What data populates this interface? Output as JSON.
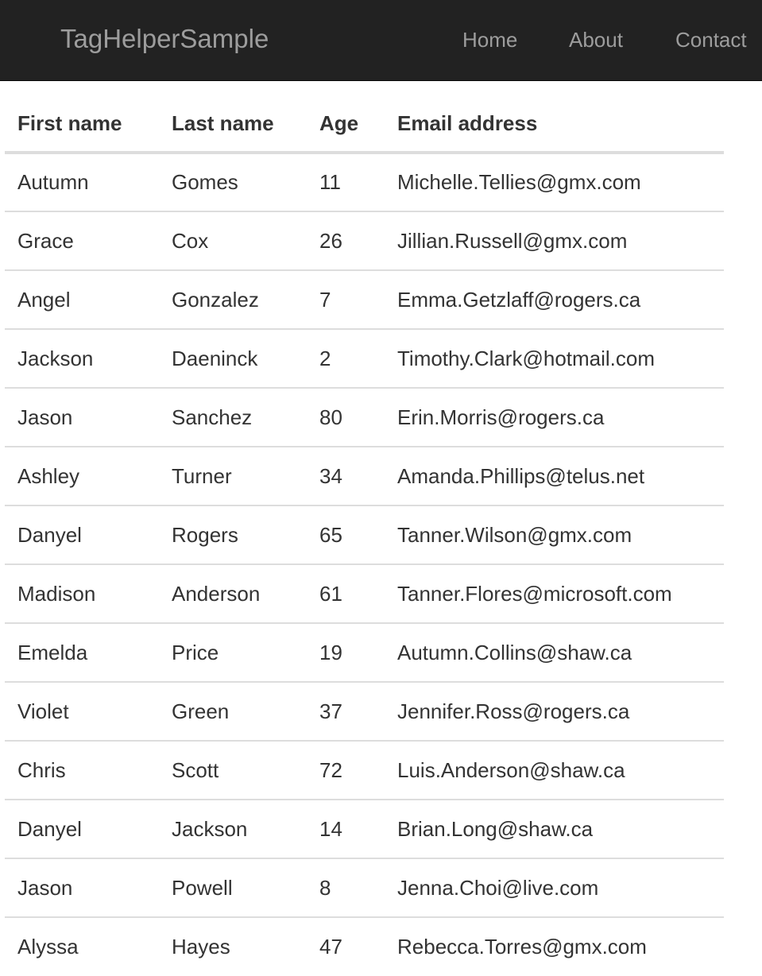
{
  "navbar": {
    "brand": "TagHelperSample",
    "links": [
      "Home",
      "About",
      "Contact"
    ]
  },
  "table": {
    "headers": [
      "First name",
      "Last name",
      "Age",
      "Email address"
    ],
    "rows": [
      [
        "Autumn",
        "Gomes",
        "11",
        "Michelle.Tellies@gmx.com"
      ],
      [
        "Grace",
        "Cox",
        "26",
        "Jillian.Russell@gmx.com"
      ],
      [
        "Angel",
        "Gonzalez",
        "7",
        "Emma.Getzlaff@rogers.ca"
      ],
      [
        "Jackson",
        "Daeninck",
        "2",
        "Timothy.Clark@hotmail.com"
      ],
      [
        "Jason",
        "Sanchez",
        "80",
        "Erin.Morris@rogers.ca"
      ],
      [
        "Ashley",
        "Turner",
        "34",
        "Amanda.Phillips@telus.net"
      ],
      [
        "Danyel",
        "Rogers",
        "65",
        "Tanner.Wilson@gmx.com"
      ],
      [
        "Madison",
        "Anderson",
        "61",
        "Tanner.Flores@microsoft.com"
      ],
      [
        "Emelda",
        "Price",
        "19",
        "Autumn.Collins@shaw.ca"
      ],
      [
        "Violet",
        "Green",
        "37",
        "Jennifer.Ross@rogers.ca"
      ],
      [
        "Chris",
        "Scott",
        "72",
        "Luis.Anderson@shaw.ca"
      ],
      [
        "Danyel",
        "Jackson",
        "14",
        "Brian.Long@shaw.ca"
      ],
      [
        "Jason",
        "Powell",
        "8",
        "Jenna.Choi@live.com"
      ],
      [
        "Alyssa",
        "Hayes",
        "47",
        "Rebecca.Torres@gmx.com"
      ]
    ]
  },
  "colors": {
    "navbar_bg": "#222222",
    "navbar_text": "#9d9d9d",
    "body_text": "#333333",
    "row_border": "#dddddd"
  }
}
